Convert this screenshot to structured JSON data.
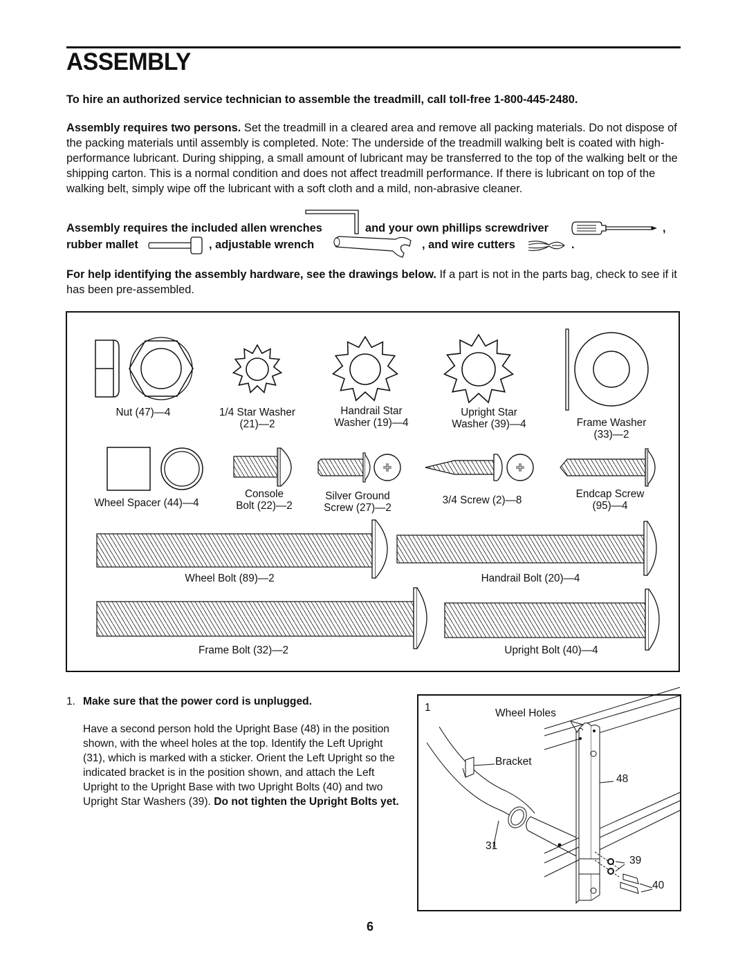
{
  "page": {
    "title": "ASSEMBLY",
    "page_number": "6"
  },
  "intro": {
    "service_call": "To hire an authorized service technician to assemble the treadmill, call toll-free 1-800-445-2480.",
    "persons_lead": "Assembly requires two persons.",
    "persons_body": " Set the treadmill in a cleared area and remove all packing materials. Do not dispose of the packing materials until assembly is completed. Note: The underside of the treadmill walking belt is coated with high-performance lubricant. During shipping, a small amount of lubricant may be transferred to the top of the walking belt or the shipping carton. This is a normal condition and does not affect treadmill performance. If there is lubricant on top of the walking belt, simply wipe off the lubricant with a soft cloth and a mild, non-abrasive cleaner."
  },
  "tools": {
    "part1": "Assembly requires the included allen wrenches",
    "part2": "and your own phillips screwdriver",
    "comma1": ",",
    "part3": "rubber mallet",
    "part4": ", adjustable wrench",
    "part5": ", and wire cutters",
    "period": ".",
    "icons": [
      "allen-wrench-icon",
      "phillips-screwdriver-icon",
      "rubber-mallet-icon",
      "adjustable-wrench-icon",
      "wire-cutters-icon"
    ]
  },
  "hardware_help": {
    "lead": "For help identifying the assembly hardware, see the drawings below.",
    "body": " If a part is not in the parts bag, check to see if it has been pre-assembled."
  },
  "parts": [
    {
      "id": "nut",
      "line1": "Nut (47)—4",
      "line2": ""
    },
    {
      "id": "star-washer",
      "line1": "1/4  Star Washer",
      "line2": "(21)—2"
    },
    {
      "id": "handrail-star-washer",
      "line1": "Handrail Star",
      "line2": "Washer (19)—4"
    },
    {
      "id": "upright-star-washer",
      "line1": "Upright Star",
      "line2": "Washer (39)—4"
    },
    {
      "id": "frame-washer",
      "line1": "Frame Washer",
      "line2": "(33)—2"
    },
    {
      "id": "wheel-spacer",
      "line1": "Wheel Spacer (44)—4",
      "line2": ""
    },
    {
      "id": "console-bolt",
      "line1": "Console",
      "line2": "Bolt (22)—2"
    },
    {
      "id": "silver-ground-screw",
      "line1": "Silver Ground",
      "line2": "Screw (27)—2"
    },
    {
      "id": "screw-3-4",
      "line1": "3/4  Screw (2)—8",
      "line2": ""
    },
    {
      "id": "endcap-screw",
      "line1": "Endcap Screw",
      "line2": "(95)—4"
    },
    {
      "id": "wheel-bolt",
      "line1": "Wheel Bolt (89)—2",
      "line2": ""
    },
    {
      "id": "handrail-bolt",
      "line1": "Handrail Bolt (20)—4",
      "line2": ""
    },
    {
      "id": "frame-bolt",
      "line1": "Frame Bolt (32)—2",
      "line2": ""
    },
    {
      "id": "upright-bolt",
      "line1": "Upright Bolt (40)—4",
      "line2": ""
    }
  ],
  "step1": {
    "number": "1.",
    "heading": "Make sure that the power cord is unplugged.",
    "body": "Have a second person hold the Upright Base (48) in the position shown, with the wheel holes at the top. Identify the Left Upright (31), which is marked with a sticker. Orient the Left Upright so the indicated bracket is in the position shown, and attach the Left Upright to the Upright Base with two Upright Bolts (40) and two Upright Star Washers (39). ",
    "warning": "Do not tighten the Upright Bolts yet."
  },
  "figure1": {
    "step_label": "1",
    "callouts": {
      "wheel_holes": "Wheel Holes",
      "bracket": "Bracket",
      "upright_base": "48",
      "left_upright": "31",
      "star_washers": "39",
      "bolts": "40"
    }
  }
}
